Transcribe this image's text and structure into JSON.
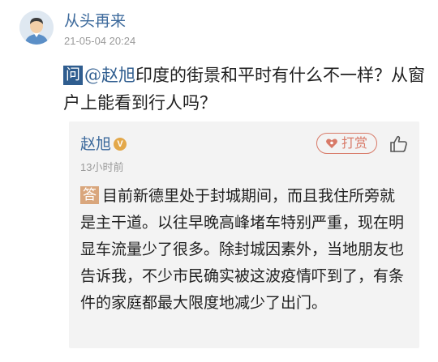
{
  "post": {
    "avatar_icon": "user-avatar-icon",
    "username": "从头再来",
    "timestamp": "21-05-04 20:24"
  },
  "question": {
    "badge": "问",
    "mention": "@赵旭",
    "text": "印度的街景和平时有什么不一样？从窗户上能看到行人吗？"
  },
  "answer": {
    "author": "赵旭",
    "verified_badge": "V",
    "tip_icon": "heart-tag-icon",
    "tip_label": "打赏",
    "like_icon": "thumbs-up-icon",
    "time": "13小时前",
    "badge": "答",
    "text": "目前新德里处于封城期间，而且我住所旁就是主干道。以往早晚高峰堵车特别严重，现在明显车流量少了很多。除封城因素外，当地朋友也告诉我，不少市民确实被这波疫情吓到了，有条件的家庭都最大限度地减少了出门。"
  },
  "colors": {
    "link": "#3d6a9c",
    "question_badge": "#2f5d8f",
    "answer_badge": "#d9a67c",
    "tip": "#d87a68",
    "verified": "#e3a84a",
    "card_bg": "#f3f3f3"
  }
}
